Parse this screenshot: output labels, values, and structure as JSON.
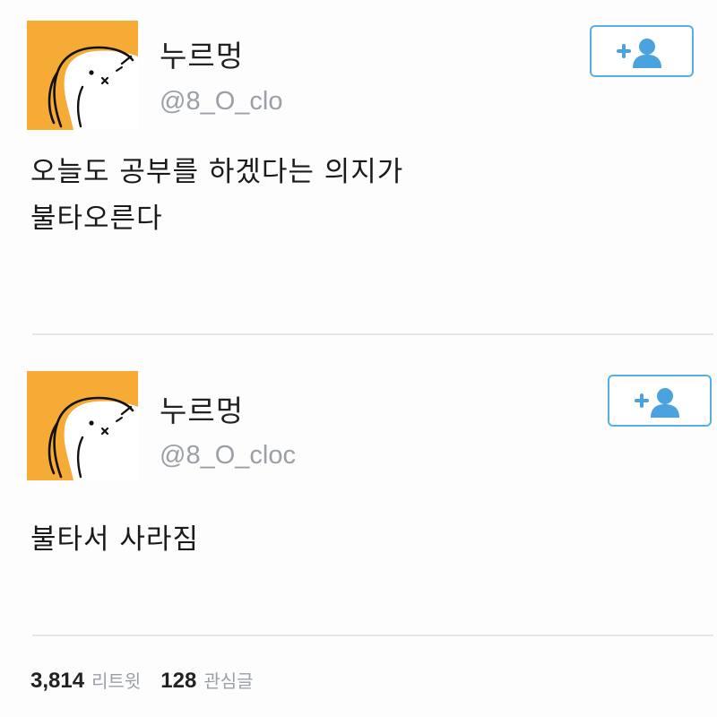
{
  "tweets": [
    {
      "display_name": "누르멍",
      "handle": "@8_O_clo",
      "text_lines": [
        "오늘도 공부를 하겠다는 의지가",
        "불타오른다"
      ],
      "follow_icon": "add-user-icon"
    },
    {
      "display_name": "누르멍",
      "handle": "@8_O_cloc",
      "text_lines": [
        "불타서 사라짐"
      ],
      "follow_icon": "add-user-icon"
    }
  ],
  "stats": {
    "retweets_count": "3,814",
    "retweets_label": "리트윗",
    "likes_count": "128",
    "likes_label": "관심글"
  },
  "colors": {
    "avatar_bg": "#f5ab35",
    "accent_blue": "#57aee6",
    "handle_gray": "#9aa0a6"
  }
}
